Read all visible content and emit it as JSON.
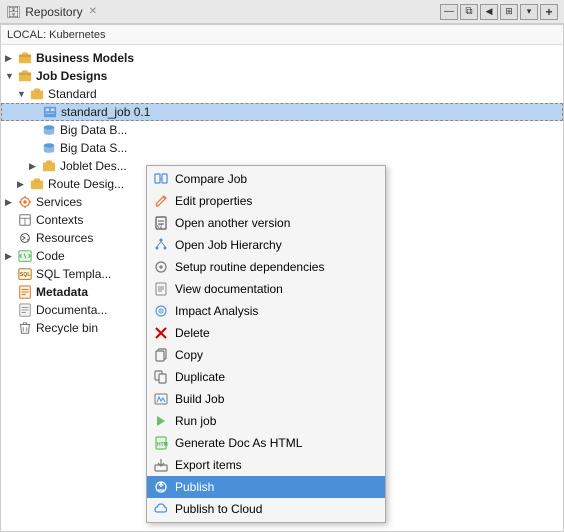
{
  "titleBar": {
    "title": "Repository",
    "buttons": [
      "minimize",
      "restore",
      "maximize",
      "settings",
      "expand",
      "options",
      "close"
    ],
    "icons": [
      "—",
      "⧉",
      "□",
      "⚙",
      "↔",
      "▾",
      "✕"
    ]
  },
  "locationBar": {
    "label": "LOCAL: Kubernetes"
  },
  "tree": {
    "items": [
      {
        "id": "business-models",
        "label": "Business Models",
        "indent": 0,
        "arrow": "collapsed",
        "bold": true,
        "icon": "folder"
      },
      {
        "id": "job-designs",
        "label": "Job Designs",
        "indent": 0,
        "arrow": "expanded",
        "bold": true,
        "icon": "folder"
      },
      {
        "id": "standard",
        "label": "Standard",
        "indent": 1,
        "arrow": "expanded",
        "bold": false,
        "icon": "folder"
      },
      {
        "id": "standard-job",
        "label": "standard_job 0.1",
        "indent": 2,
        "arrow": "leaf",
        "bold": false,
        "icon": "job",
        "highlighted": true
      },
      {
        "id": "big-data-b",
        "label": "Big Data B...",
        "indent": 2,
        "arrow": "leaf",
        "bold": false,
        "icon": "db"
      },
      {
        "id": "big-data-s",
        "label": "Big Data S...",
        "indent": 2,
        "arrow": "leaf",
        "bold": false,
        "icon": "db"
      },
      {
        "id": "joblet-des",
        "label": "Joblet Des...",
        "indent": 2,
        "arrow": "collapsed",
        "bold": false,
        "icon": "folder"
      },
      {
        "id": "route-desi",
        "label": "Route Desig...",
        "indent": 1,
        "arrow": "collapsed",
        "bold": false,
        "icon": "folder"
      },
      {
        "id": "services",
        "label": "Services",
        "indent": 0,
        "arrow": "collapsed",
        "bold": false,
        "icon": "service"
      },
      {
        "id": "contexts",
        "label": "Contexts",
        "indent": 0,
        "arrow": "leaf",
        "bold": false,
        "icon": "context"
      },
      {
        "id": "resources",
        "label": "Resources",
        "indent": 0,
        "arrow": "leaf",
        "bold": false,
        "icon": "resource"
      },
      {
        "id": "code",
        "label": "Code",
        "indent": 0,
        "arrow": "collapsed",
        "bold": false,
        "icon": "code"
      },
      {
        "id": "sql-templa",
        "label": "SQL Templa...",
        "indent": 0,
        "arrow": "leaf",
        "bold": false,
        "icon": "sql"
      },
      {
        "id": "metadata",
        "label": "Metadata",
        "indent": 0,
        "arrow": "leaf",
        "bold": true,
        "icon": "meta"
      },
      {
        "id": "documenta",
        "label": "Documenta...",
        "indent": 0,
        "arrow": "leaf",
        "bold": false,
        "icon": "doc"
      },
      {
        "id": "recycle-bin",
        "label": "Recycle bin",
        "indent": 0,
        "arrow": "leaf",
        "bold": false,
        "icon": "trash"
      }
    ]
  },
  "contextMenu": {
    "items": [
      {
        "id": "compare-job",
        "label": "Compare Job",
        "icon": "compare",
        "type": "item"
      },
      {
        "id": "edit-properties",
        "label": "Edit properties",
        "icon": "edit",
        "type": "item"
      },
      {
        "id": "open-another-version",
        "label": "Open another version",
        "icon": "version",
        "type": "item"
      },
      {
        "id": "open-job-hierarchy",
        "label": "Open Job Hierarchy",
        "icon": "hierarchy",
        "type": "item"
      },
      {
        "id": "setup-routine",
        "label": "Setup routine dependencies",
        "icon": "setup",
        "type": "item"
      },
      {
        "id": "view-documentation",
        "label": "View documentation",
        "icon": "doc",
        "type": "item"
      },
      {
        "id": "impact-analysis",
        "label": "Impact Analysis",
        "icon": "impact",
        "type": "item"
      },
      {
        "id": "delete",
        "label": "Delete",
        "icon": "delete",
        "type": "item"
      },
      {
        "id": "copy",
        "label": "Copy",
        "icon": "copy",
        "type": "item"
      },
      {
        "id": "duplicate",
        "label": "Duplicate",
        "icon": "duplicate",
        "type": "item"
      },
      {
        "id": "build-job",
        "label": "Build Job",
        "icon": "build",
        "type": "item"
      },
      {
        "id": "run-job",
        "label": "Run job",
        "icon": "run",
        "type": "item"
      },
      {
        "id": "generate-doc",
        "label": "Generate Doc As HTML",
        "icon": "gendoc",
        "type": "item"
      },
      {
        "id": "export-items",
        "label": "Export items",
        "icon": "export",
        "type": "item"
      },
      {
        "id": "publish",
        "label": "Publish",
        "icon": "publish",
        "type": "item",
        "active": true
      },
      {
        "id": "publish-cloud",
        "label": "Publish to Cloud",
        "icon": "cloud",
        "type": "item"
      }
    ]
  }
}
